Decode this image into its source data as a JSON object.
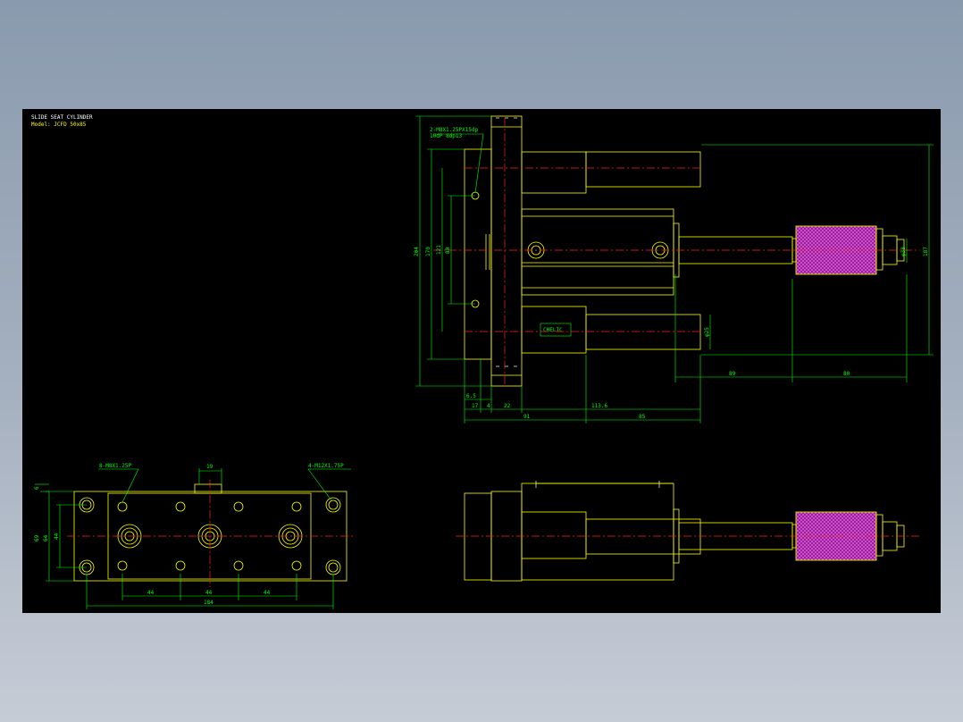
{
  "drawing": {
    "title": "SLIDE SEAT CYLINDER",
    "model": "Model: JCFD 50x85",
    "note": {
      "thread_line1": "2-M8X1.25PX15dp",
      "thread_line2": "10dP 8dp13"
    },
    "badge_text": "CHELIC",
    "top_view_dims": {
      "h204": "204",
      "h170": "170",
      "h121": "121",
      "h80": "80",
      "phi25": "φ25",
      "phi38": "φ38",
      "h187": "187",
      "w89": "89",
      "w80": "80",
      "w6_5": "6.5",
      "w17": "17",
      "w4": "4",
      "w22": "22",
      "w113_6": "113.6",
      "w91": "91",
      "w85": "85"
    },
    "base_view_dims": {
      "thread_left": "8-M8X1.25P",
      "thread_right": "4-M12X1.75P",
      "w19": "19",
      "h6": "6",
      "h69": "69",
      "h64": "64",
      "h44": "44",
      "w44a": "44",
      "w44b": "44",
      "w44c": "44",
      "w184": "184"
    }
  },
  "colors": {
    "background": "#000000",
    "frame": "#8a9aae",
    "outline": "#ffff00",
    "dimension": "#00ff00",
    "centerline": "#ff2020",
    "hatch": "#cc33cc"
  }
}
